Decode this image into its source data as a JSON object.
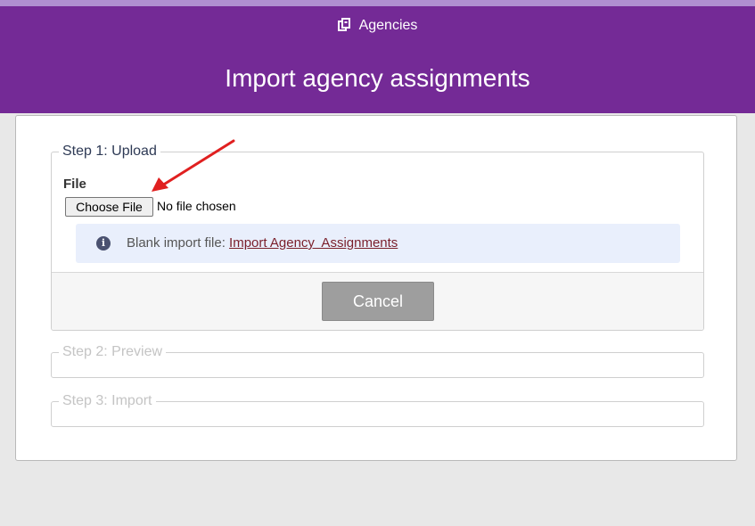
{
  "header": {
    "breadcrumb_icon": "agencies-icon",
    "breadcrumb_label": "Agencies",
    "title": "Import agency assignments",
    "background": "#742a96"
  },
  "steps": [
    {
      "legend": "Step 1: Upload",
      "file": {
        "label": "File",
        "button_label": "Choose File",
        "status": "No file chosen"
      },
      "info": {
        "icon": "info-icon",
        "text": "Blank import file:",
        "link_text": "Import Agency  Assignments"
      },
      "cancel_label": "Cancel"
    },
    {
      "legend": "Step 2: Preview"
    },
    {
      "legend": "Step 3: Import"
    }
  ],
  "annotation": {
    "arrow_color": "#e02020"
  }
}
